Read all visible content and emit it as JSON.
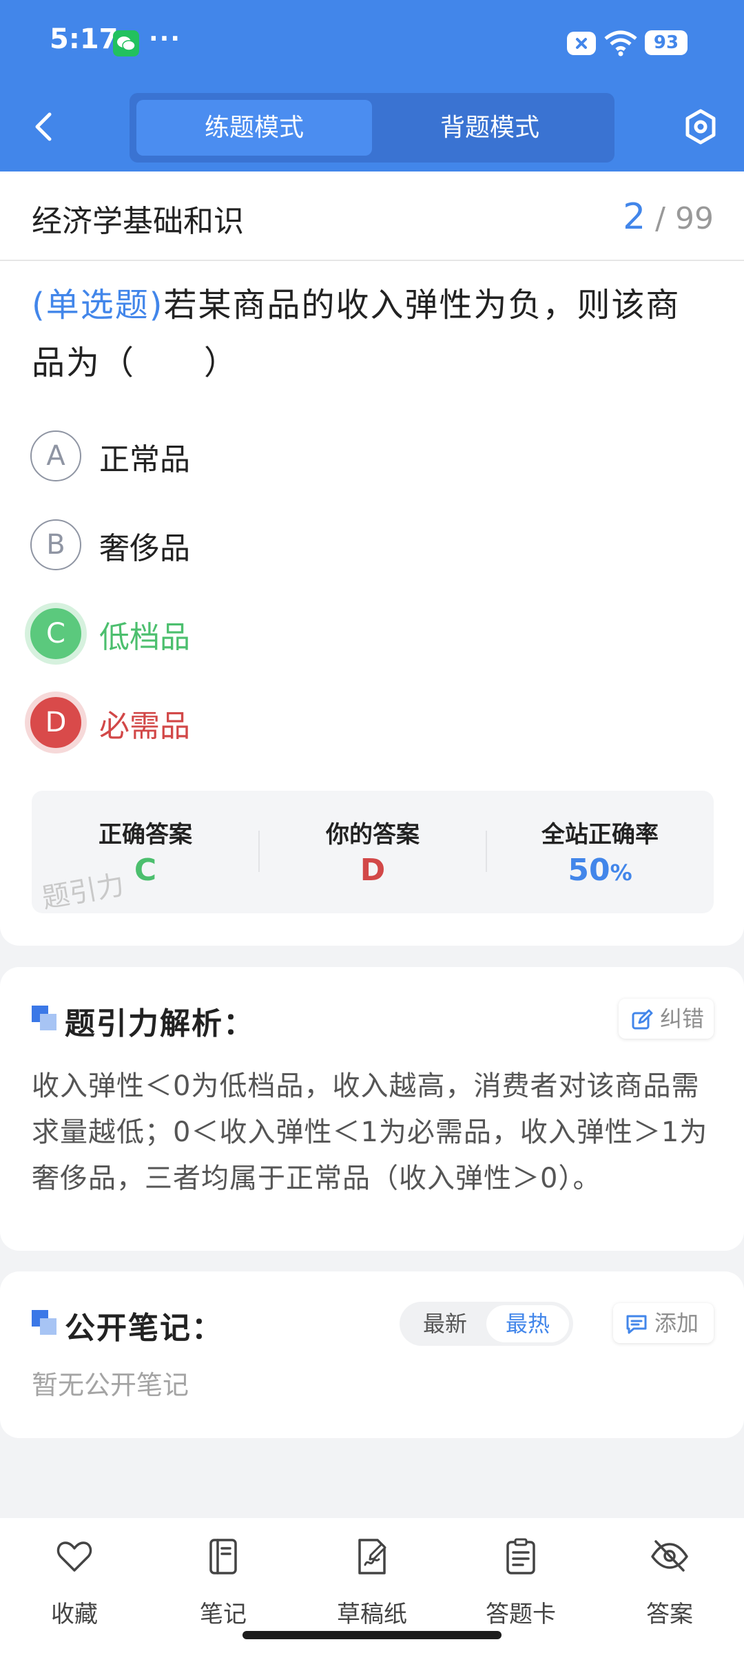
{
  "status_bar": {
    "time": "5:17",
    "dots": "···",
    "battery": "93",
    "icons": [
      "wechat-icon",
      "close-badge-icon",
      "wifi-icon",
      "battery-icon"
    ]
  },
  "header": {
    "modes": [
      {
        "label": "练题模式",
        "active": true
      },
      {
        "label": "背题模式",
        "active": false
      }
    ],
    "icons": [
      "back-icon",
      "settings-icon"
    ]
  },
  "subject": {
    "title": "经济学基础和识",
    "current": "2",
    "separator": "/",
    "total": "99"
  },
  "question": {
    "type": "(单选题)",
    "text": "若某商品的收入弹性为负，则该商品为（　　）",
    "options": [
      {
        "letter": "A",
        "label": "正常品",
        "state": "default"
      },
      {
        "letter": "B",
        "label": "奢侈品",
        "state": "default"
      },
      {
        "letter": "C",
        "label": "低档品",
        "state": "correct"
      },
      {
        "letter": "D",
        "label": "必需品",
        "state": "wrong"
      }
    ]
  },
  "answer_summary": {
    "correct_label": "正确答案",
    "correct_value": "C",
    "yours_label": "你的答案",
    "yours_value": "D",
    "rate_label": "全站正确率",
    "rate_value": "50",
    "rate_unit": "%",
    "watermark": "题引力",
    "colors": {
      "correct": "#4cbf6e",
      "wrong": "#d24848",
      "rate": "#4286ea"
    }
  },
  "analysis": {
    "title": "题引力解析：",
    "report_label": "纠错",
    "text": "收入弹性＜0为低档品，收入越高，消费者对该商品需求量越低；0＜收入弹性＜1为必需品，收入弹性＞1为奢侈品，三者均属于正常品（收入弹性＞0）。"
  },
  "notes": {
    "title": "公开笔记：",
    "sort_latest": "最新",
    "sort_hot": "最热",
    "add_label": "添加",
    "empty_text": "暂无公开笔记"
  },
  "bottom_nav": [
    {
      "label": "收藏",
      "icon": "heart-icon"
    },
    {
      "label": "笔记",
      "icon": "notebook-icon"
    },
    {
      "label": "草稿纸",
      "icon": "draft-paper-icon"
    },
    {
      "label": "答题卡",
      "icon": "answer-sheet-icon"
    },
    {
      "label": "答案",
      "icon": "eye-off-icon"
    }
  ],
  "colors": {
    "accent": "#4286ea",
    "header_bg": "#4286ea",
    "page_bg": "#f2f3f5"
  }
}
